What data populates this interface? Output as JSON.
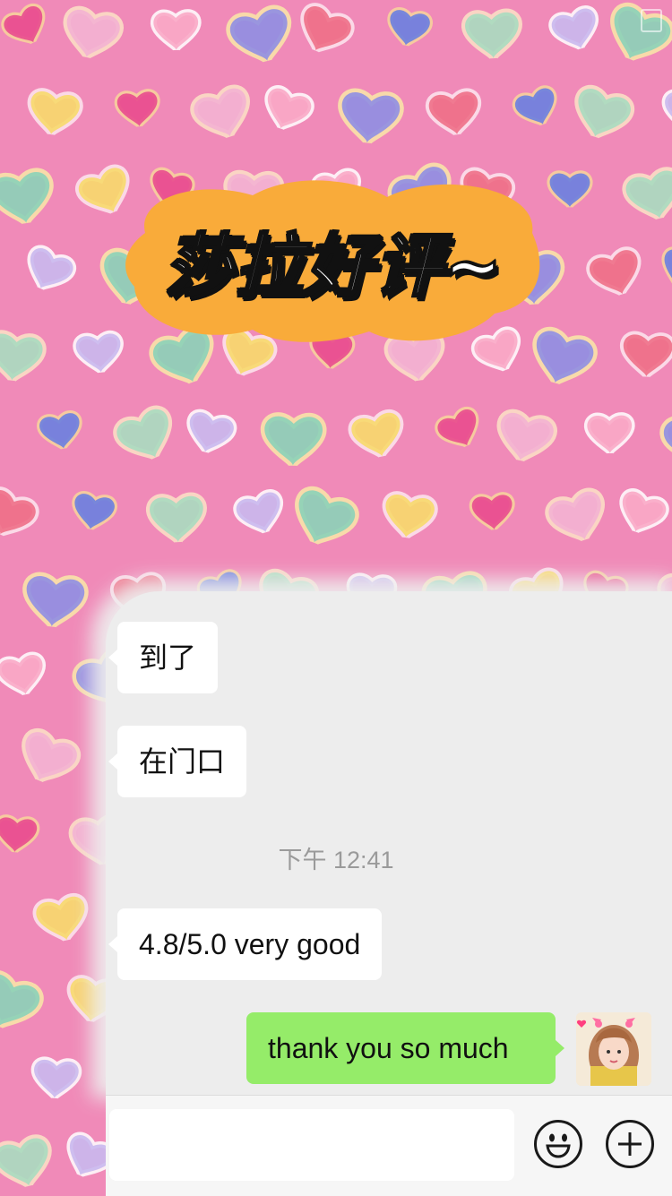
{
  "sticker": {
    "title": "莎拉好评~",
    "colors": {
      "blob": "#f9ab3a",
      "text": "#ffffff",
      "outline": "#111111"
    }
  },
  "chat": {
    "messages": [
      {
        "side": "left",
        "text": "到了"
      },
      {
        "side": "left",
        "text": "在门口"
      },
      {
        "side": "left",
        "text": "4.8/5.0 very good"
      },
      {
        "side": "right",
        "text": "thank you so much"
      }
    ],
    "timestamp": "下午 12:41"
  },
  "input": {
    "value": "",
    "placeholder": ""
  },
  "toolbar": {
    "emoji_icon": "emoji-smile-icon",
    "plus_icon": "plus-circle-icon"
  },
  "colors": {
    "wallpaper": "#f08ab8",
    "chat_bg": "#ededed",
    "bubble_in": "#ffffff",
    "bubble_out": "#95ec69",
    "timestamp": "#9a9a9a"
  }
}
